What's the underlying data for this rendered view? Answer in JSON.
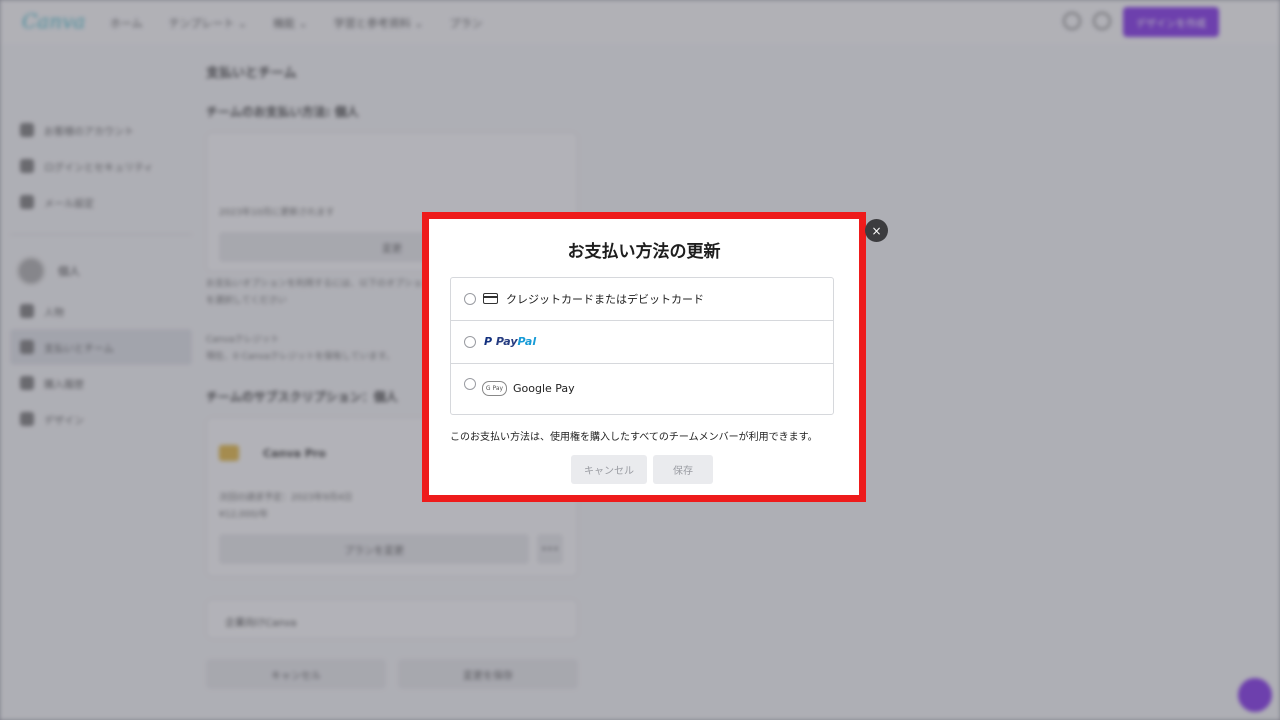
{
  "background": {
    "logo": "Canva",
    "nav": [
      "ホーム",
      "テンプレート ⌄",
      "機能 ⌄",
      "学習と参考資料 ⌄",
      "プラン"
    ],
    "create_button": "デザインを作成",
    "sidebar": {
      "items_top": [
        "お客様のアカウント",
        "ログインとセキュリティ",
        "メール設定"
      ],
      "team_name": "個人",
      "items_bottom": [
        "人物",
        "支払いとチーム",
        "購入履歴",
        "デザイン"
      ]
    },
    "main": {
      "heading": "支払いとチーム",
      "subheading": "チームのお支払い方法: 個人",
      "renew_text": "2023年10月に更新されます",
      "renew_button": "変更",
      "payment_note": "お支払いオプションを利用するには、以下のオプションを選択してください",
      "credit_heading": "Canvaクレジット",
      "credit_text": "現在、0 Canvaクレジットを保有しています。",
      "subscription_heading": "チームのサブスクリプション：個人",
      "plan_name": "Canva Pro",
      "next_billing": "次回の請求予定：2023年9月4日",
      "price": "¥12,000/年",
      "change_plan": "プランを変更",
      "more": "•••",
      "invoice_heading": "企業向けCanva",
      "footer_cancel": "キャンセル",
      "footer_save": "変更を保存"
    }
  },
  "modal": {
    "title": "お支払い方法の更新",
    "close_glyph": "×",
    "options": [
      {
        "label": "クレジットカードまたはデビットカード",
        "icon": "credit-card-icon"
      },
      {
        "label_parts": [
          "P",
          "Pay",
          "Pal"
        ],
        "icon": "paypal-logo"
      },
      {
        "icon_text": "G Pay",
        "label": "Google Pay",
        "icon": "google-pay-icon"
      }
    ],
    "note": "このお支払い方法は、使用権を購入したすべてのチームメンバーが利用できます。",
    "cancel_label": "キャンセル",
    "save_label": "保存"
  },
  "colors": {
    "highlight_border": "#ee1b1b",
    "brand_purple": "#7d2ae8",
    "paypal_dark": "#253b80",
    "paypal_light": "#179bd7"
  }
}
